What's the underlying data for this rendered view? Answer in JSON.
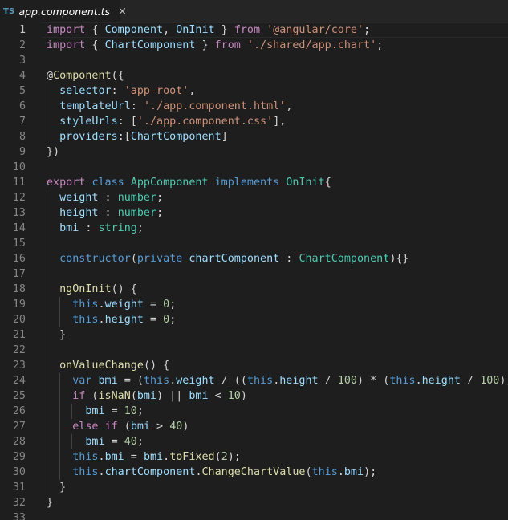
{
  "tab": {
    "lang_badge": "TS",
    "filename": "app.component.ts",
    "close_glyph": "×"
  },
  "current_line": 1,
  "lines": [
    {
      "n": "1",
      "indent": 0,
      "tokens": [
        [
          "ctl",
          "import"
        ],
        [
          "pl",
          " { "
        ],
        [
          "prop",
          "Component"
        ],
        [
          "pl",
          ", "
        ],
        [
          "prop",
          "OnInit"
        ],
        [
          "pl",
          " } "
        ],
        [
          "ctl",
          "from"
        ],
        [
          "pl",
          " "
        ],
        [
          "str",
          "'@angular/core'"
        ],
        [
          "pl",
          ";"
        ]
      ]
    },
    {
      "n": "2",
      "indent": 0,
      "tokens": [
        [
          "ctl",
          "import"
        ],
        [
          "pl",
          " { "
        ],
        [
          "prop",
          "ChartComponent"
        ],
        [
          "pl",
          " } "
        ],
        [
          "ctl",
          "from"
        ],
        [
          "pl",
          " "
        ],
        [
          "str",
          "'./shared/app.chart'"
        ],
        [
          "pl",
          ";"
        ]
      ]
    },
    {
      "n": "3",
      "indent": 0,
      "tokens": []
    },
    {
      "n": "4",
      "indent": 0,
      "tokens": [
        [
          "pl",
          "@"
        ],
        [
          "fn",
          "Component"
        ],
        [
          "pl",
          "({"
        ]
      ]
    },
    {
      "n": "5",
      "indent": 1,
      "tokens": [
        [
          "pl",
          "  "
        ],
        [
          "prop",
          "selector"
        ],
        [
          "pl",
          ": "
        ],
        [
          "str",
          "'app-root'"
        ],
        [
          "pl",
          ","
        ]
      ]
    },
    {
      "n": "6",
      "indent": 1,
      "tokens": [
        [
          "pl",
          "  "
        ],
        [
          "prop",
          "templateUrl"
        ],
        [
          "pl",
          ": "
        ],
        [
          "str",
          "'./app.component.html'"
        ],
        [
          "pl",
          ","
        ]
      ]
    },
    {
      "n": "7",
      "indent": 1,
      "tokens": [
        [
          "pl",
          "  "
        ],
        [
          "prop",
          "styleUrls"
        ],
        [
          "pl",
          ": ["
        ],
        [
          "str",
          "'./app.component.css'"
        ],
        [
          "pl",
          "],"
        ]
      ]
    },
    {
      "n": "8",
      "indent": 1,
      "tokens": [
        [
          "pl",
          "  "
        ],
        [
          "prop",
          "providers"
        ],
        [
          "pl",
          ":["
        ],
        [
          "prop",
          "ChartComponent"
        ],
        [
          "pl",
          "]"
        ]
      ]
    },
    {
      "n": "9",
      "indent": 0,
      "tokens": [
        [
          "pl",
          "})"
        ]
      ]
    },
    {
      "n": "10",
      "indent": 0,
      "tokens": []
    },
    {
      "n": "11",
      "indent": 0,
      "tokens": [
        [
          "ctl",
          "export"
        ],
        [
          "pl",
          " "
        ],
        [
          "kw",
          "class"
        ],
        [
          "pl",
          " "
        ],
        [
          "type",
          "AppComponent"
        ],
        [
          "pl",
          " "
        ],
        [
          "kw",
          "implements"
        ],
        [
          "pl",
          " "
        ],
        [
          "type",
          "OnInit"
        ],
        [
          "pl",
          "{"
        ]
      ]
    },
    {
      "n": "12",
      "indent": 1,
      "tokens": [
        [
          "pl",
          "  "
        ],
        [
          "prop",
          "weight"
        ],
        [
          "pl",
          " : "
        ],
        [
          "type",
          "number"
        ],
        [
          "pl",
          ";"
        ]
      ]
    },
    {
      "n": "13",
      "indent": 1,
      "tokens": [
        [
          "pl",
          "  "
        ],
        [
          "prop",
          "height"
        ],
        [
          "pl",
          " : "
        ],
        [
          "type",
          "number"
        ],
        [
          "pl",
          ";"
        ]
      ]
    },
    {
      "n": "14",
      "indent": 1,
      "tokens": [
        [
          "pl",
          "  "
        ],
        [
          "prop",
          "bmi"
        ],
        [
          "pl",
          " : "
        ],
        [
          "type",
          "string"
        ],
        [
          "pl",
          ";"
        ]
      ]
    },
    {
      "n": "15",
      "indent": 1,
      "tokens": []
    },
    {
      "n": "16",
      "indent": 1,
      "tokens": [
        [
          "pl",
          "  "
        ],
        [
          "kw",
          "constructor"
        ],
        [
          "pl",
          "("
        ],
        [
          "kw",
          "private"
        ],
        [
          "pl",
          " "
        ],
        [
          "prop",
          "chartComponent"
        ],
        [
          "pl",
          " : "
        ],
        [
          "type",
          "ChartComponent"
        ],
        [
          "pl",
          "){}"
        ]
      ]
    },
    {
      "n": "17",
      "indent": 1,
      "tokens": []
    },
    {
      "n": "18",
      "indent": 1,
      "tokens": [
        [
          "pl",
          "  "
        ],
        [
          "fn",
          "ngOnInit"
        ],
        [
          "pl",
          "() {"
        ]
      ]
    },
    {
      "n": "19",
      "indent": 2,
      "tokens": [
        [
          "pl",
          "    "
        ],
        [
          "kw",
          "this"
        ],
        [
          "pl",
          "."
        ],
        [
          "prop",
          "weight"
        ],
        [
          "pl",
          " = "
        ],
        [
          "num",
          "0"
        ],
        [
          "pl",
          ";"
        ]
      ]
    },
    {
      "n": "20",
      "indent": 2,
      "tokens": [
        [
          "pl",
          "    "
        ],
        [
          "kw",
          "this"
        ],
        [
          "pl",
          "."
        ],
        [
          "prop",
          "height"
        ],
        [
          "pl",
          " = "
        ],
        [
          "num",
          "0"
        ],
        [
          "pl",
          ";"
        ]
      ]
    },
    {
      "n": "21",
      "indent": 1,
      "tokens": [
        [
          "pl",
          "  }"
        ]
      ]
    },
    {
      "n": "22",
      "indent": 1,
      "tokens": []
    },
    {
      "n": "23",
      "indent": 1,
      "tokens": [
        [
          "pl",
          "  "
        ],
        [
          "fn",
          "onValueChange"
        ],
        [
          "pl",
          "() {"
        ]
      ]
    },
    {
      "n": "24",
      "indent": 2,
      "tokens": [
        [
          "pl",
          "    "
        ],
        [
          "kw",
          "var"
        ],
        [
          "pl",
          " "
        ],
        [
          "prop",
          "bmi"
        ],
        [
          "pl",
          " = ("
        ],
        [
          "kw",
          "this"
        ],
        [
          "pl",
          "."
        ],
        [
          "prop",
          "weight"
        ],
        [
          "pl",
          " / (("
        ],
        [
          "kw",
          "this"
        ],
        [
          "pl",
          "."
        ],
        [
          "prop",
          "height"
        ],
        [
          "pl",
          " / "
        ],
        [
          "num",
          "100"
        ],
        [
          "pl",
          ") * ("
        ],
        [
          "kw",
          "this"
        ],
        [
          "pl",
          "."
        ],
        [
          "prop",
          "height"
        ],
        [
          "pl",
          " / "
        ],
        [
          "num",
          "100"
        ],
        [
          "pl",
          ")));"
        ]
      ]
    },
    {
      "n": "25",
      "indent": 2,
      "tokens": [
        [
          "pl",
          "    "
        ],
        [
          "ctl",
          "if"
        ],
        [
          "pl",
          " ("
        ],
        [
          "fn",
          "isNaN"
        ],
        [
          "pl",
          "("
        ],
        [
          "prop",
          "bmi"
        ],
        [
          "pl",
          ") || "
        ],
        [
          "prop",
          "bmi"
        ],
        [
          "pl",
          " < "
        ],
        [
          "num",
          "10"
        ],
        [
          "pl",
          ")"
        ]
      ]
    },
    {
      "n": "26",
      "indent": 3,
      "tokens": [
        [
          "pl",
          "      "
        ],
        [
          "prop",
          "bmi"
        ],
        [
          "pl",
          " = "
        ],
        [
          "num",
          "10"
        ],
        [
          "pl",
          ";"
        ]
      ]
    },
    {
      "n": "27",
      "indent": 2,
      "tokens": [
        [
          "pl",
          "    "
        ],
        [
          "ctl",
          "else"
        ],
        [
          "pl",
          " "
        ],
        [
          "ctl",
          "if"
        ],
        [
          "pl",
          " ("
        ],
        [
          "prop",
          "bmi"
        ],
        [
          "pl",
          " > "
        ],
        [
          "num",
          "40"
        ],
        [
          "pl",
          ")"
        ]
      ]
    },
    {
      "n": "28",
      "indent": 3,
      "tokens": [
        [
          "pl",
          "      "
        ],
        [
          "prop",
          "bmi"
        ],
        [
          "pl",
          " = "
        ],
        [
          "num",
          "40"
        ],
        [
          "pl",
          ";"
        ]
      ]
    },
    {
      "n": "29",
      "indent": 2,
      "tokens": [
        [
          "pl",
          "    "
        ],
        [
          "kw",
          "this"
        ],
        [
          "pl",
          "."
        ],
        [
          "prop",
          "bmi"
        ],
        [
          "pl",
          " = "
        ],
        [
          "prop",
          "bmi"
        ],
        [
          "pl",
          "."
        ],
        [
          "fn",
          "toFixed"
        ],
        [
          "pl",
          "("
        ],
        [
          "num",
          "2"
        ],
        [
          "pl",
          ");"
        ]
      ]
    },
    {
      "n": "30",
      "indent": 2,
      "tokens": [
        [
          "pl",
          "    "
        ],
        [
          "kw",
          "this"
        ],
        [
          "pl",
          "."
        ],
        [
          "prop",
          "chartComponent"
        ],
        [
          "pl",
          "."
        ],
        [
          "fn",
          "ChangeChartValue"
        ],
        [
          "pl",
          "("
        ],
        [
          "kw",
          "this"
        ],
        [
          "pl",
          "."
        ],
        [
          "prop",
          "bmi"
        ],
        [
          "pl",
          ");"
        ]
      ]
    },
    {
      "n": "31",
      "indent": 1,
      "tokens": [
        [
          "pl",
          "  }"
        ]
      ]
    },
    {
      "n": "32",
      "indent": 0,
      "tokens": [
        [
          "pl",
          "}"
        ]
      ]
    },
    {
      "n": "33",
      "indent": 0,
      "tokens": []
    }
  ]
}
